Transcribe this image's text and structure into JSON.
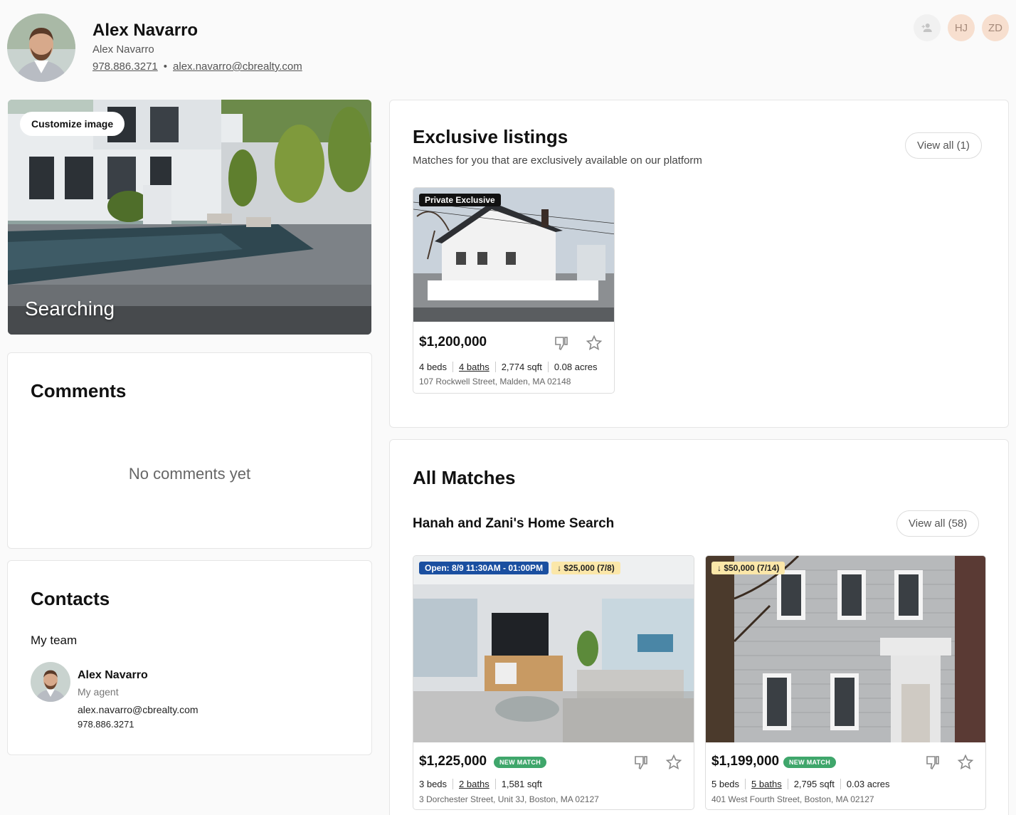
{
  "header": {
    "name": "Alex Navarro",
    "subname": "Alex Navarro",
    "phone": "978.886.3271",
    "separator": "•",
    "email": "alex.navarro@cbrealty.com",
    "avatars": [
      {
        "initials": "HJ"
      },
      {
        "initials": "ZD"
      }
    ]
  },
  "hero": {
    "customize_label": "Customize image",
    "status": "Searching"
  },
  "comments": {
    "title": "Comments",
    "empty": "No comments yet"
  },
  "contacts": {
    "title": "Contacts",
    "team_label": "My team",
    "member": {
      "name": "Alex Navarro",
      "role": "My agent",
      "email": "alex.navarro@cbrealty.com",
      "phone": "978.886.3271"
    }
  },
  "exclusive": {
    "title": "Exclusive listings",
    "subtitle": "Matches for you that are exclusively available on our platform",
    "view_all": "View all (1)",
    "listing": {
      "badge": "Private Exclusive",
      "price": "$1,200,000",
      "beds": "4 beds",
      "baths": "4 baths",
      "sqft": "2,774 sqft",
      "acres": "0.08 acres",
      "address": "107 Rockwell Street, Malden, MA 02148"
    }
  },
  "matches": {
    "title": "All Matches",
    "search_name": "Hanah and Zani's Home Search",
    "view_all": "View all (58)",
    "listings": [
      {
        "open_house": "Open: 8/9 11:30AM - 01:00PM",
        "price_drop": "↓ $25,000 (7/8)",
        "price": "$1,225,000",
        "tag": "NEW MATCH",
        "beds": "3 beds",
        "baths": "2 baths",
        "sqft": "1,581 sqft",
        "address": "3 Dorchester Street, Unit 3J, Boston, MA 02127"
      },
      {
        "price_drop": "↓ $50,000 (7/14)",
        "price": "$1,199,000",
        "tag": "NEW MATCH",
        "beds": "5 beds",
        "baths": "5 baths",
        "sqft": "2,795 sqft",
        "acres": "0.03 acres",
        "address": "401 West Fourth Street, Boston, MA 02127"
      }
    ]
  },
  "colors": {
    "accent_blue": "#1a4fa0",
    "new_match_green": "#3fa66b",
    "price_drop_yellow": "#fbe7a9"
  }
}
